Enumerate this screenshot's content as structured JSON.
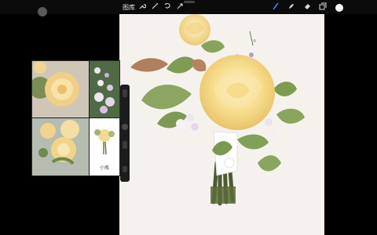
{
  "app": {
    "gallery_label": "图库"
  },
  "toolbar": {
    "left_tools": [
      "wrench-icon",
      "magic-wand-icon",
      "selection-icon",
      "transform-icon"
    ],
    "right_tools": [
      "brush-icon",
      "smudge-icon",
      "eraser-icon",
      "layers-icon"
    ],
    "active_color": "#ffffff",
    "active_tool_color": "#3b82f6"
  },
  "reference": {
    "caption": "小瓶"
  }
}
